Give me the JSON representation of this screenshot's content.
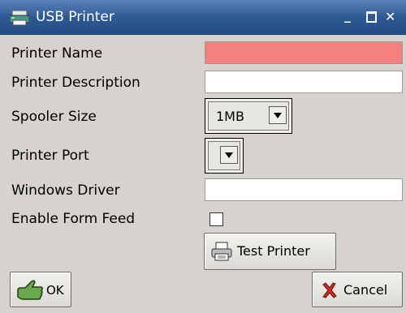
{
  "window": {
    "title": "USB Printer",
    "controls": {
      "minimize": "_",
      "close": "✕"
    }
  },
  "form": {
    "printer_name": {
      "label": "Printer Name",
      "value": "",
      "required": true
    },
    "printer_description": {
      "label": "Printer Description",
      "value": ""
    },
    "spooler_size": {
      "label": "Spooler Size",
      "value": "1MB"
    },
    "printer_port": {
      "label": "Printer Port",
      "value": ""
    },
    "windows_driver": {
      "label": "Windows Driver",
      "value": ""
    },
    "enable_form_feed": {
      "label": "Enable Form Feed",
      "checked": false
    }
  },
  "buttons": {
    "test_printer": "Test Printer",
    "ok": "OK",
    "cancel": "Cancel"
  },
  "icons": {
    "app": "printer-app-icon",
    "test": "printer-icon",
    "ok": "ok-hand-icon",
    "cancel": "red-x-icon"
  },
  "colors": {
    "titlebar": "#2e5a94",
    "required_field": "#f58080",
    "background": "#d6d3ce"
  }
}
